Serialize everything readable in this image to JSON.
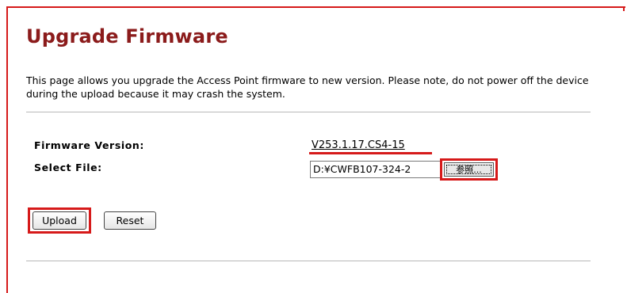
{
  "page": {
    "title": "Upgrade Firmware",
    "description": "This page allows you upgrade the Access Point firmware to new version. Please note, do not power off the device during the upload because it may crash the system."
  },
  "form": {
    "firmware_version_label": "Firmware Version:",
    "firmware_version_value": "V253.1.17.CS4-15",
    "select_file_label": "Select File:",
    "file_value": "D:¥CWFB107-324-2",
    "browse_label": "参照..."
  },
  "buttons": {
    "upload_label": "Upload",
    "reset_label": "Reset"
  },
  "colors": {
    "title": "#8b1b1b",
    "highlight": "#d61a1a"
  }
}
